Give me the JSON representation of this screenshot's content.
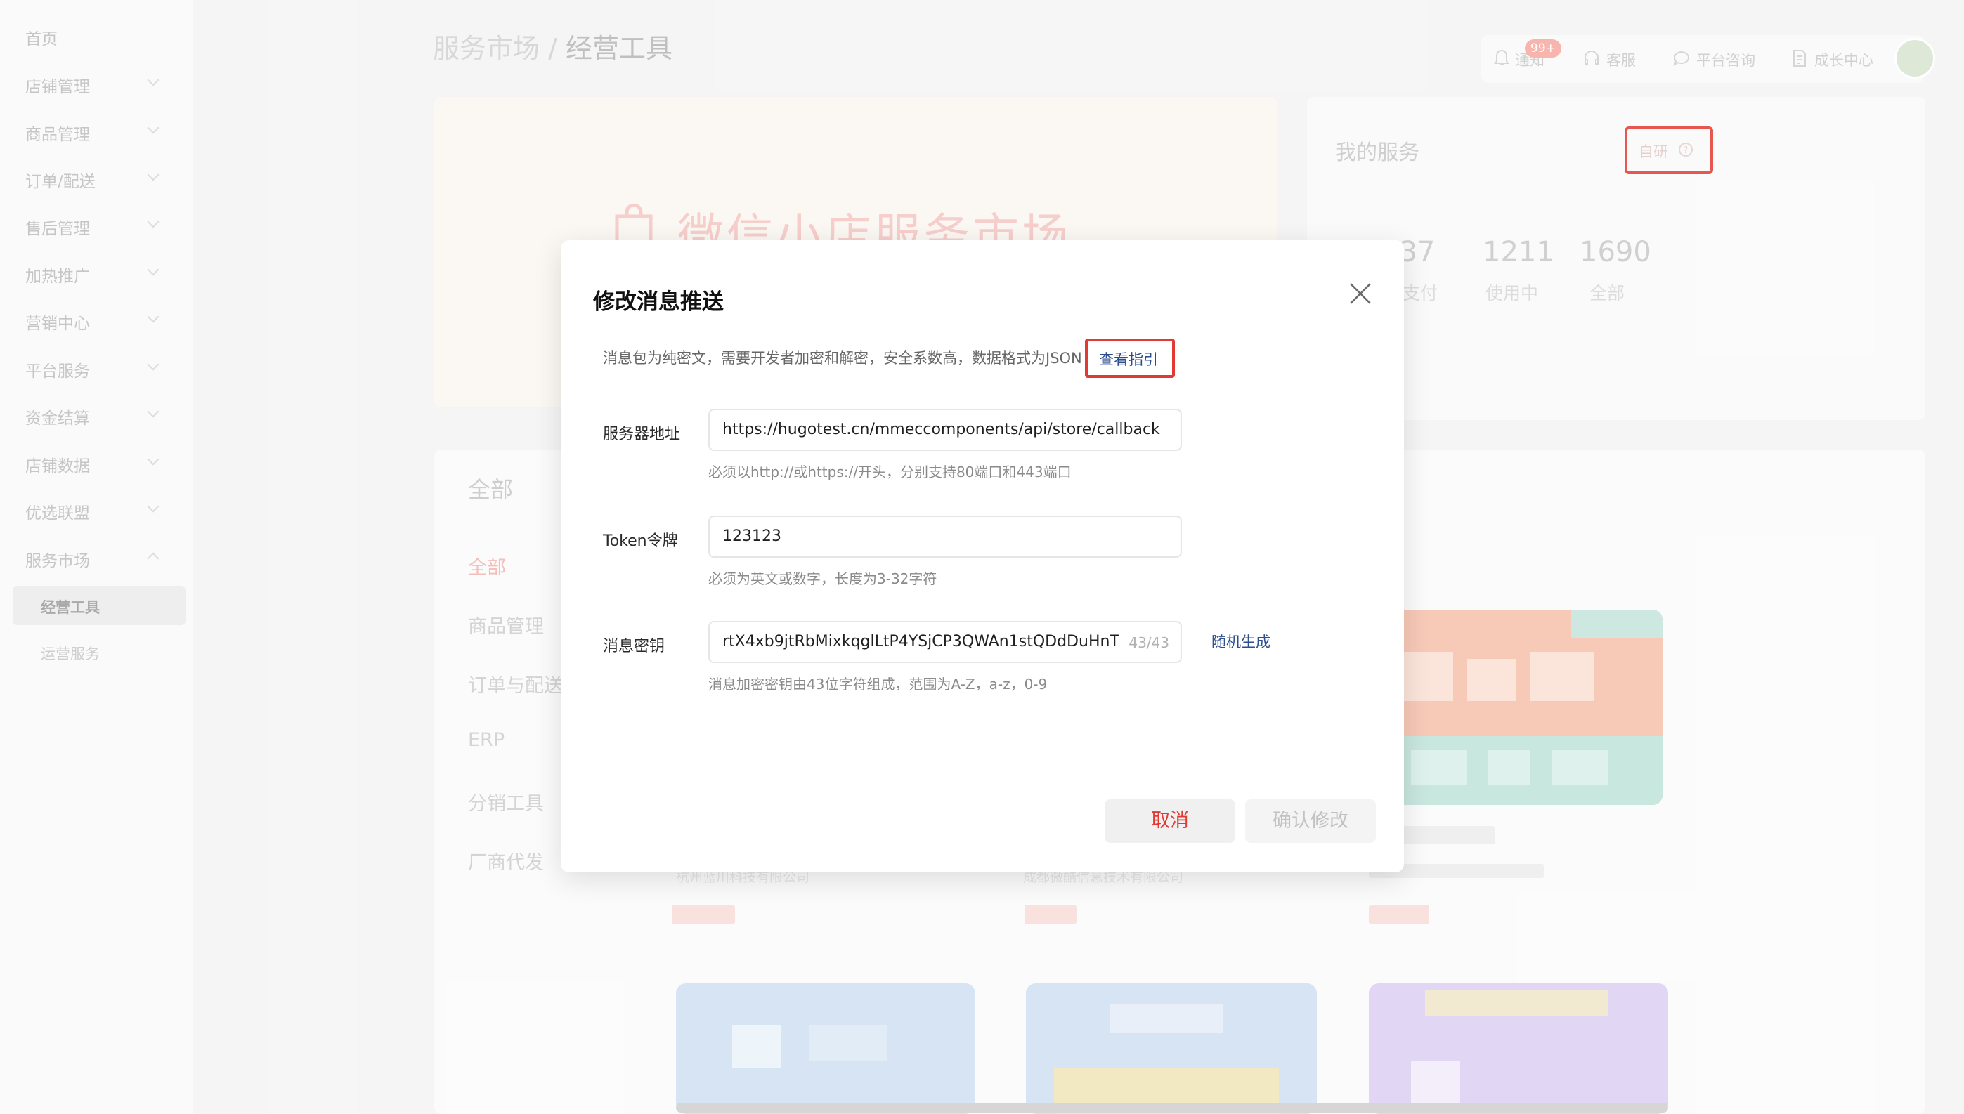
{
  "sidebar": {
    "home": "首页",
    "items": [
      "店铺管理",
      "商品管理",
      "订单/配送",
      "售后管理",
      "加热推广",
      "营销中心",
      "平台服务",
      "资金结算",
      "店铺数据",
      "优选联盟",
      "服务市场"
    ],
    "sub_items": [
      "经营工具",
      "运营服务"
    ]
  },
  "breadcrumb": {
    "parent": "服务市场",
    "separator": "/",
    "current": "经营工具"
  },
  "topbar": {
    "notify": "通知",
    "notify_badge": "99+",
    "support": "客服",
    "consult": "平台咨询",
    "growth": "成长中心"
  },
  "banner": {
    "title": "微信小店服务市场"
  },
  "my_services": {
    "title": "我的服务",
    "tag": "自研",
    "stats": [
      {
        "value": "137",
        "label": "支付"
      },
      {
        "value": "1211",
        "label": "使用中"
      },
      {
        "value": "1690",
        "label": "全部"
      }
    ]
  },
  "categories": {
    "heading": "全部",
    "items": [
      "全部",
      "商品管理",
      "订单与配送",
      "ERP",
      "分销工具",
      "厂商代发"
    ]
  },
  "cards": {
    "company_1": "杭州蓝川科技有限公司",
    "company_2": "成都微酷信息技术有限公司",
    "company_3": "ˎ"
  },
  "modal": {
    "title": "修改消息推送",
    "description": "消息包为纯密文，需要开发者加密和解密，安全系数高，数据格式为JSON",
    "guide_link": "查看指引",
    "server_url": {
      "label": "服务器地址",
      "value": "https://hugotest.cn/mmeccomponents/api/store/callback",
      "hint": "必须以http://或https://开头，分别支持80端口和443端口"
    },
    "token": {
      "label": "Token令牌",
      "value": "123123",
      "hint": "必须为英文或数字，长度为3-32字符"
    },
    "aes_key": {
      "label": "消息密钥",
      "value": "rtX4xb9jtRbMixkqglLtP4YSjCP3QWAn1stQDdDuHnT",
      "counter": "43/43",
      "hint": "消息加密密钥由43位字符组成，范围为A-Z，a-z，0-9",
      "random_link": "随机生成"
    },
    "cancel_label": "取消",
    "confirm_label": "确认修改"
  },
  "colors": {
    "accent_red": "#e23a32",
    "link_blue": "#2c4d8c",
    "card_orange": "#f6c0ab",
    "card_teal": "#bfe3d9",
    "card_blue": "#cfe0f2",
    "card_purple": "#dcd0f2"
  }
}
